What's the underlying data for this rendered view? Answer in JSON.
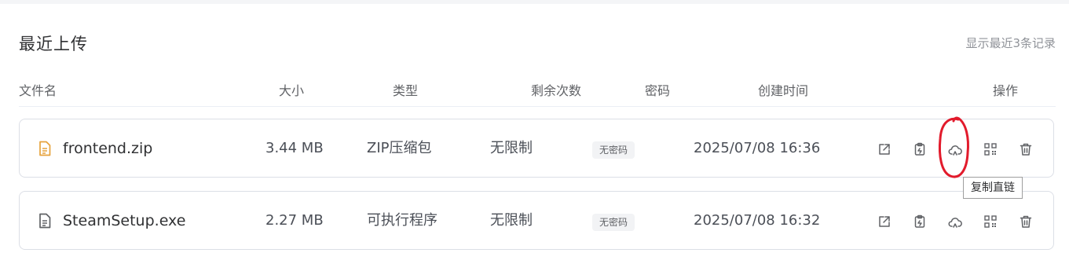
{
  "section": {
    "title": "最近上传",
    "limit_note": "显示最近3条记录"
  },
  "table": {
    "columns": {
      "name": "文件名",
      "size": "大小",
      "type": "类型",
      "remaining": "剩余次数",
      "password": "密码",
      "created": "创建时间",
      "actions": "操作"
    },
    "rows": [
      {
        "name": "frontend.zip",
        "size": "3.44 MB",
        "type": "ZIP压缩包",
        "remaining": "无限制",
        "password": "无密码",
        "created": "2025/07/08 16:36",
        "icon": "zip-file-icon",
        "icon_color": "#e6a23c"
      },
      {
        "name": "SteamSetup.exe",
        "size": "2.27 MB",
        "type": "可执行程序",
        "remaining": "无限制",
        "password": "无密码",
        "created": "2025/07/08 16:32",
        "icon": "file-icon",
        "icon_color": "#606266"
      }
    ],
    "actions": [
      "open-link-icon",
      "copy-icon",
      "cloud-link-icon",
      "qrcode-icon",
      "trash-icon"
    ]
  },
  "tooltip": {
    "text": "复制直链"
  },
  "annotation": {
    "color": "#e21b2c"
  }
}
